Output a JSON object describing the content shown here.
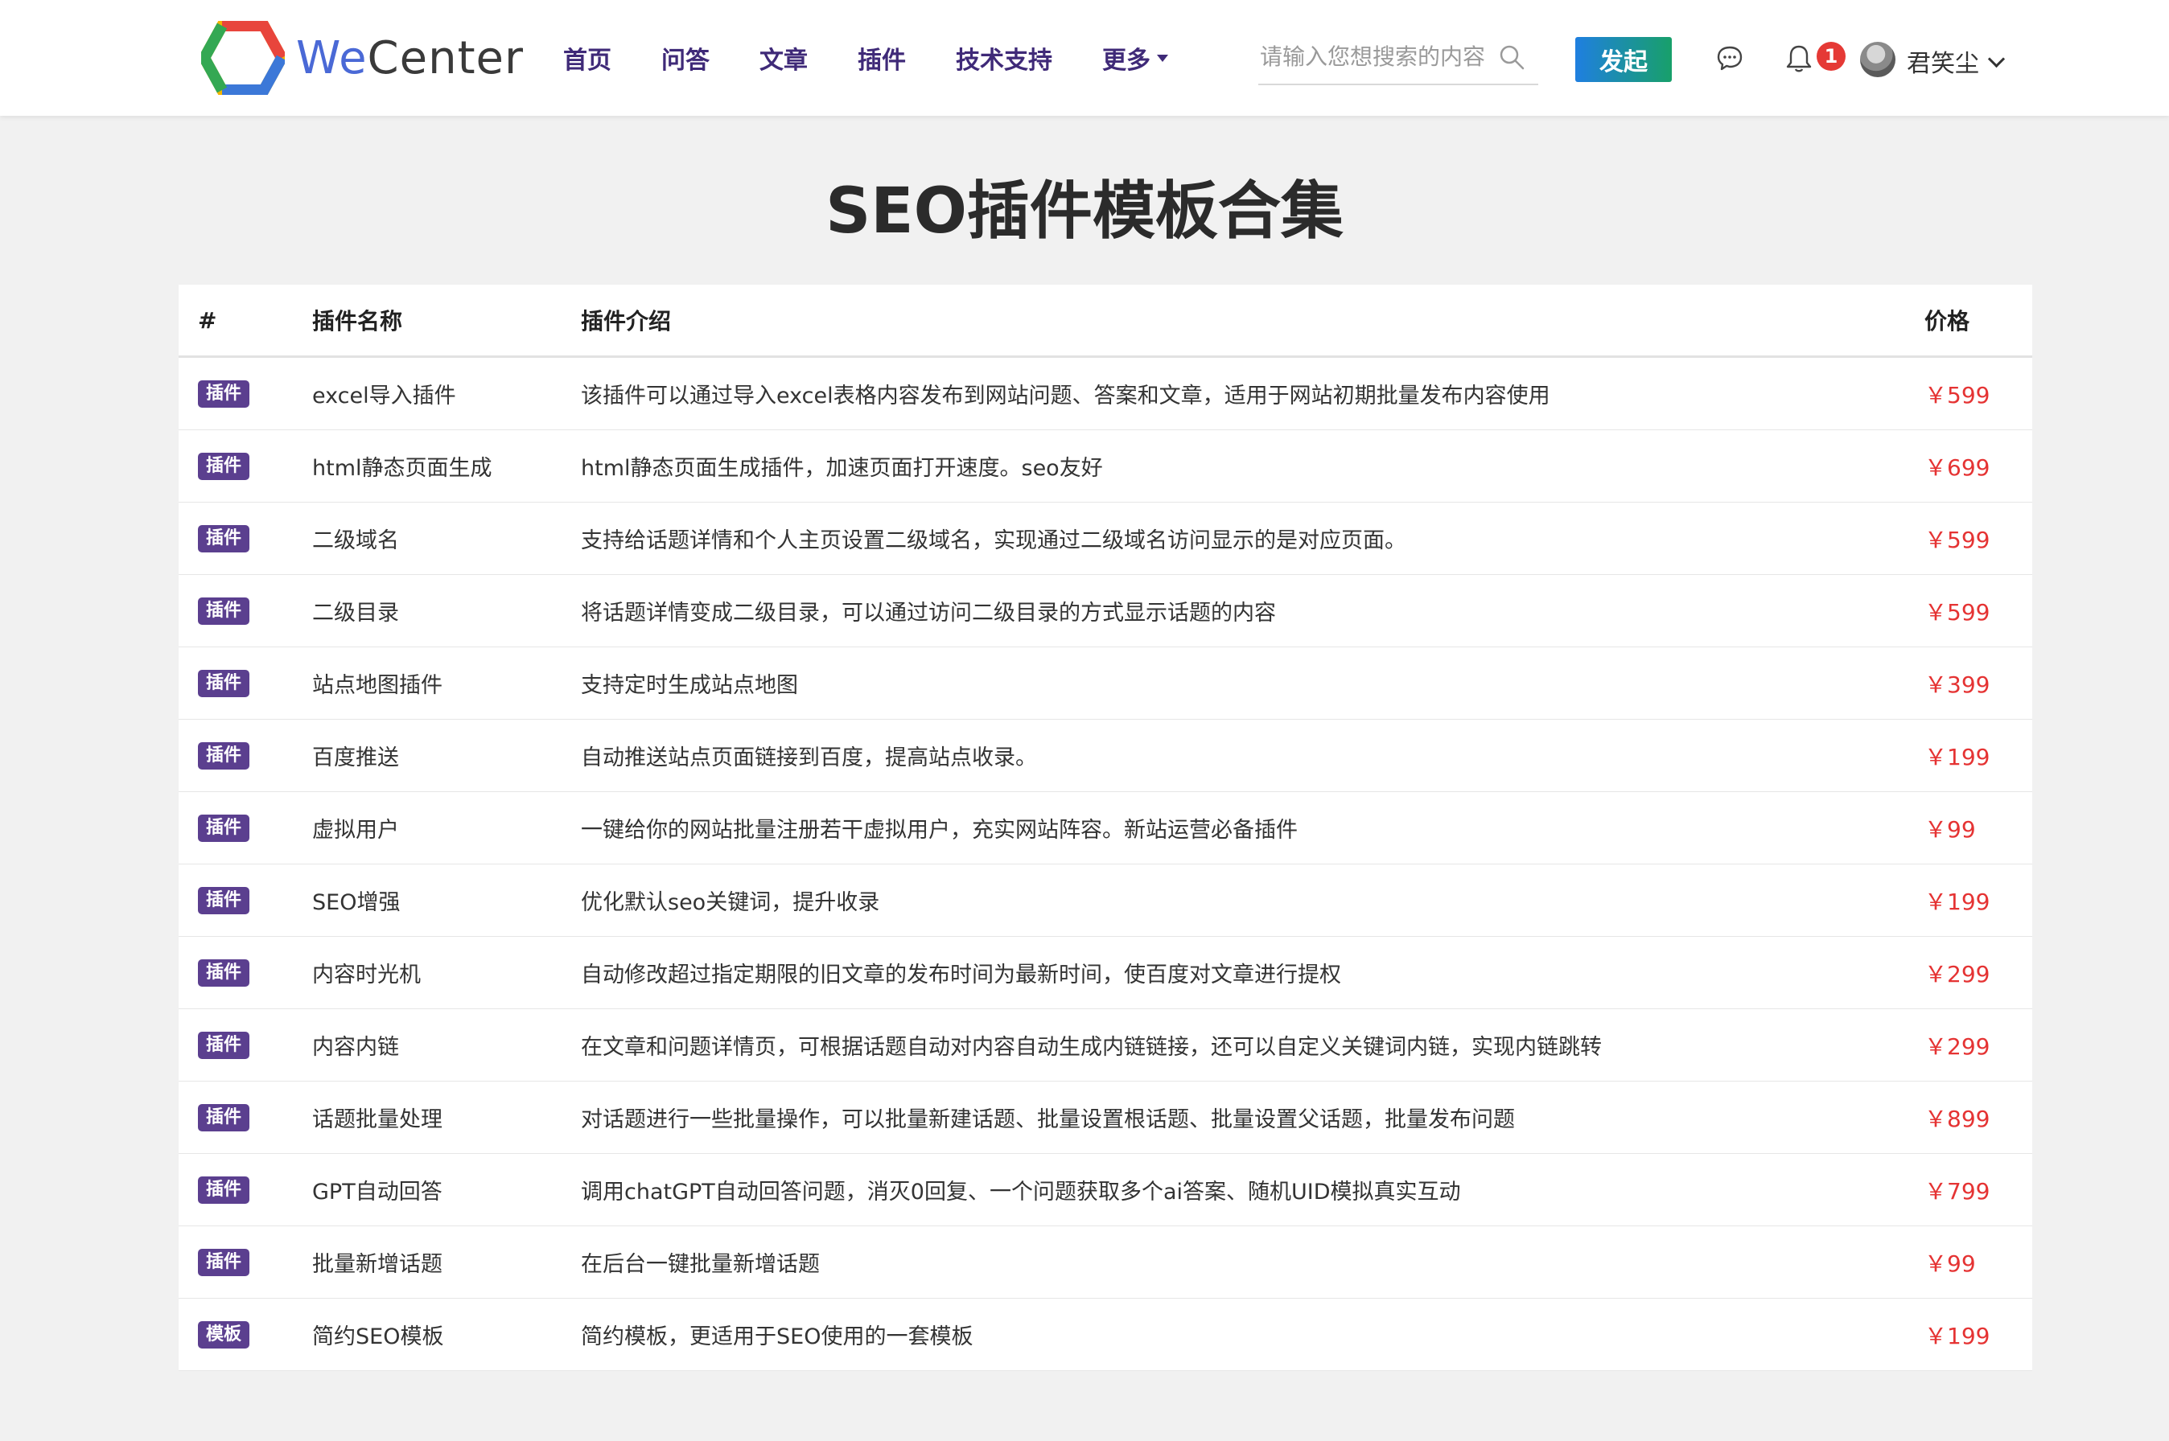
{
  "header": {
    "logo_text_part1": "We",
    "logo_text_part2": "Center",
    "nav": [
      {
        "label": "首页"
      },
      {
        "label": "问答"
      },
      {
        "label": "文章"
      },
      {
        "label": "插件"
      },
      {
        "label": "技术支持"
      },
      {
        "label": "更多"
      }
    ],
    "search_placeholder": "请输入您想搜索的内容",
    "start_button": "发起",
    "notification_count": "1",
    "username": "君笑尘"
  },
  "page_title": "SEO插件模板合集",
  "table": {
    "columns": [
      "#",
      "插件名称",
      "插件介绍",
      "价格"
    ],
    "rows": [
      {
        "tag": "插件",
        "name": "excel导入插件",
        "desc": "该插件可以通过导入excel表格内容发布到网站问题、答案和文章，适用于网站初期批量发布内容使用",
        "price": "￥599"
      },
      {
        "tag": "插件",
        "name": "html静态页面生成",
        "desc": "html静态页面生成插件，加速页面打开速度。seo友好",
        "price": "￥699"
      },
      {
        "tag": "插件",
        "name": "二级域名",
        "desc": "支持给话题详情和个人主页设置二级域名，实现通过二级域名访问显示的是对应页面。",
        "price": "￥599"
      },
      {
        "tag": "插件",
        "name": "二级目录",
        "desc": "将话题详情变成二级目录，可以通过访问二级目录的方式显示话题的内容",
        "price": "￥599"
      },
      {
        "tag": "插件",
        "name": "站点地图插件",
        "desc": "支持定时生成站点地图",
        "price": "￥399"
      },
      {
        "tag": "插件",
        "name": "百度推送",
        "desc": "自动推送站点页面链接到百度，提高站点收录。",
        "price": "￥199"
      },
      {
        "tag": "插件",
        "name": "虚拟用户",
        "desc": "一键给你的网站批量注册若干虚拟用户，充实网站阵容。新站运营必备插件",
        "price": "￥99"
      },
      {
        "tag": "插件",
        "name": "SEO增强",
        "desc": "优化默认seo关键词，提升收录",
        "price": "￥199"
      },
      {
        "tag": "插件",
        "name": "内容时光机",
        "desc": "自动修改超过指定期限的旧文章的发布时间为最新时间，使百度对文章进行提权",
        "price": "￥299"
      },
      {
        "tag": "插件",
        "name": "内容内链",
        "desc": "在文章和问题详情页，可根据话题自动对内容自动生成内链链接，还可以自定义关键词内链，实现内链跳转",
        "price": "￥299"
      },
      {
        "tag": "插件",
        "name": "话题批量处理",
        "desc": "对话题进行一些批量操作，可以批量新建话题、批量设置根话题、批量设置父话题，批量发布问题",
        "price": "￥899"
      },
      {
        "tag": "插件",
        "name": "GPT自动回答",
        "desc": "调用chatGPT自动回答问题，消灭0回复、一个问题获取多个ai答案、随机UID模拟真实互动",
        "price": "￥799"
      },
      {
        "tag": "插件",
        "name": "批量新增话题",
        "desc": "在后台一键批量新增话题",
        "price": "￥99"
      },
      {
        "tag": "模板",
        "name": "简约SEO模板",
        "desc": "简约模板，更适用于SEO使用的一套模板",
        "price": "￥199"
      }
    ]
  },
  "colors": {
    "nav_text": "#3f2a78",
    "tag_bg": "#5b3f8f",
    "price": "#e53333",
    "badge": "#e53935"
  },
  "icons": [
    "logo-hexagon-icon",
    "search-icon",
    "message-icon",
    "bell-icon",
    "chevron-down-icon"
  ]
}
